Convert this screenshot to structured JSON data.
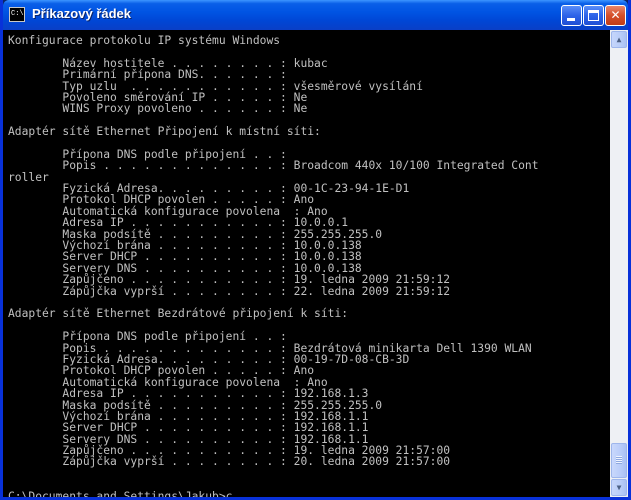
{
  "window": {
    "title": "Příkazový řádek",
    "app_icon_text": "C:\\",
    "buttons": {
      "minimize": "_",
      "maximize": "□",
      "close": "✕"
    }
  },
  "console": {
    "lines": [
      "Konfigurace protokolu IP systému Windows",
      "",
      "        Název hostitele . . . . . . . . : kubac",
      "        Primární přípona DNS. . . . . . :",
      "        Typ uzlu  . . . . . . . . . . . : všesměrové vysílání",
      "        Povoleno směrování IP . . . . . : Ne",
      "        WINS Proxy povoleno . . . . . . : Ne",
      "",
      "Adaptér sítě Ethernet Připojení k místní síti:",
      "",
      "        Přípona DNS podle připojení . . :",
      "        Popis . . . . . . . . . . . . . : Broadcom 440x 10/100 Integrated Cont",
      "roller",
      "        Fyzická Adresa. . . . . . . . . : 00-1C-23-94-1E-D1",
      "        Protokol DHCP povolen . . . . . : Ano",
      "        Automatická konfigurace povolena  : Ano",
      "        Adresa IP . . . . . . . . . . . : 10.0.0.1",
      "        Maska podsítě . . . . . . . . . : 255.255.255.0",
      "        Výchozí brána . . . . . . . . . : 10.0.0.138",
      "        Server DHCP . . . . . . . . . . : 10.0.0.138",
      "        Servery DNS . . . . . . . . . . : 10.0.0.138",
      "        Zapůjčeno . . . . . . . . . . . : 19. ledna 2009 21:59:12",
      "        Zápůjčka vyprší . . . . . . . . : 22. ledna 2009 21:59:12",
      "",
      "Adaptér sítě Ethernet Bezdrátové připojení k síti:",
      "",
      "        Přípona DNS podle připojení . . :",
      "        Popis . . . . . . . . . . . . . : Bezdrátová minikarta Dell 1390 WLAN",
      "        Fyzická Adresa. . . . . . . . . : 00-19-7D-08-CB-3D",
      "        Protokol DHCP povolen . . . . . : Ano",
      "        Automatická konfigurace povolena  : Ano",
      "        Adresa IP . . . . . . . . . . . : 192.168.1.3",
      "        Maska podsítě . . . . . . . . . : 255.255.255.0",
      "        Výchozí brána . . . . . . . . . : 192.168.1.1",
      "        Server DHCP . . . . . . . . . . : 192.168.1.1",
      "        Servery DNS . . . . . . . . . . : 192.168.1.1",
      "        Zapůjčeno . . . . . . . . . . . : 19. ledna 2009 21:57:00",
      "        Zápůjčka vyprší . . . . . . . . : 20. ledna 2009 21:57:00",
      "",
      ""
    ],
    "prompt": "C:\\Documents and Settings\\Jakub>c",
    "text_color": "#c0c0c0",
    "background_color": "#000000"
  },
  "scrollbar": {
    "up_arrow": "▲",
    "down_arrow": "▼"
  }
}
